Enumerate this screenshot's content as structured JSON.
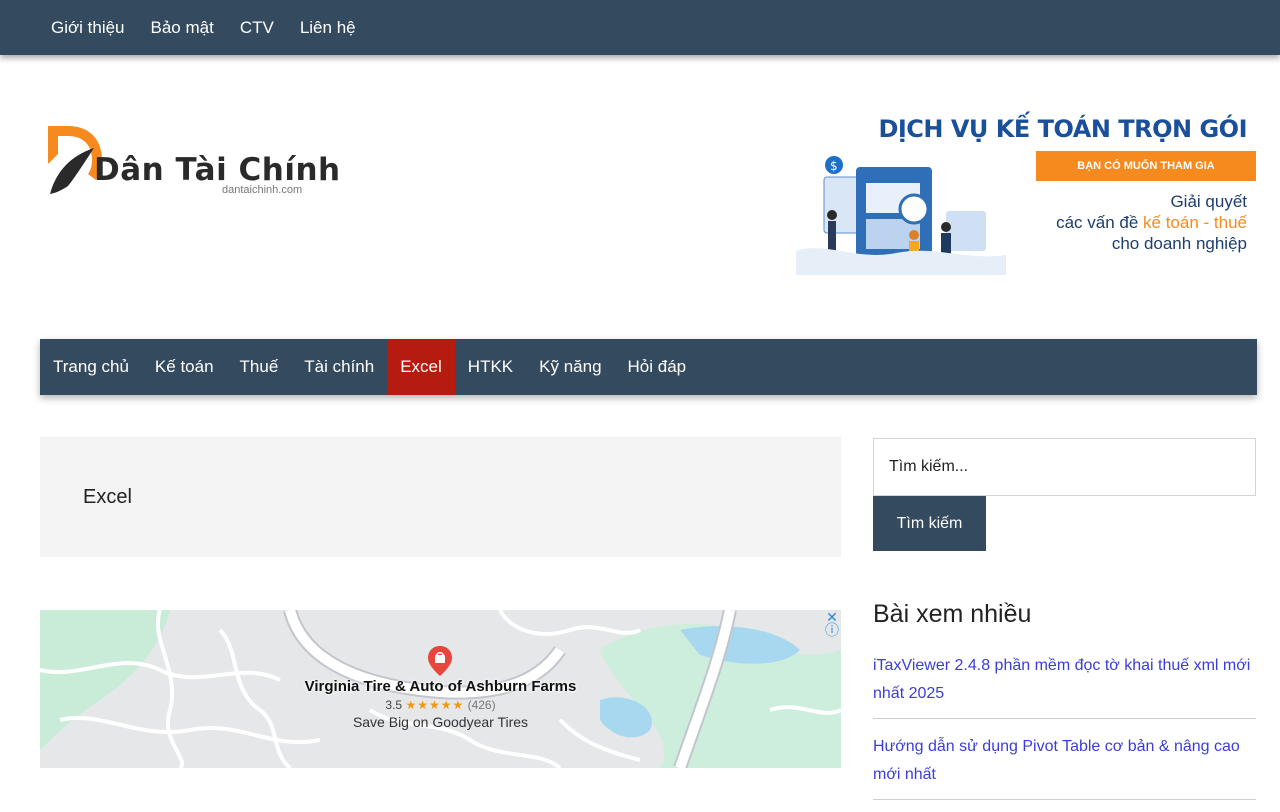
{
  "topbar": {
    "menu": [
      "Giới thiệu",
      "Bảo mật",
      "CTV",
      "Liên hệ"
    ]
  },
  "header": {
    "logo_text": "Dân Tài Chính",
    "logo_domain": "dantaichinh.com",
    "banner": {
      "title": "DỊCH VỤ KẾ TOÁN TRỌN GÓI",
      "pill": "BẠN CÓ MUỐN THAM GIA",
      "line1": "Giải quyết",
      "line2_prefix": "các vấn đề ",
      "line2_highlight": "kế toán - thuế",
      "line3": "cho doanh nghiệp"
    }
  },
  "mainnav": {
    "items": [
      "Trang chủ",
      "Kế toán",
      "Thuế",
      "Tài chính",
      "Excel",
      "HTKK",
      "Kỹ năng",
      "Hỏi đáp"
    ],
    "active": "Excel"
  },
  "page": {
    "title": "Excel"
  },
  "ad": {
    "place_name": "Virginia Tire & Auto of Ashburn Farms",
    "rating": "3.5",
    "stars": "★★★★★",
    "review_count": "(426)",
    "subtitle": "Save Big on Goodyear Tires",
    "close_glyph": "✕",
    "info_glyph": "ⓘ"
  },
  "sidebar": {
    "search_placeholder": "Tìm kiếm...",
    "search_button": "Tìm kiếm",
    "widget_title": "Bài xem nhiều",
    "posts": [
      "iTaxViewer 2.4.8 phần mềm đọc tờ khai thuế xml mới nhất 2025",
      "Hướng dẫn sử dụng Pivot Table cơ bản & nâng cao mới nhất"
    ]
  },
  "colors": {
    "nav_bg": "#344a5f",
    "active_bg": "#b51b0f",
    "link": "#3a3ddb",
    "brand_orange": "#f68a1f"
  }
}
